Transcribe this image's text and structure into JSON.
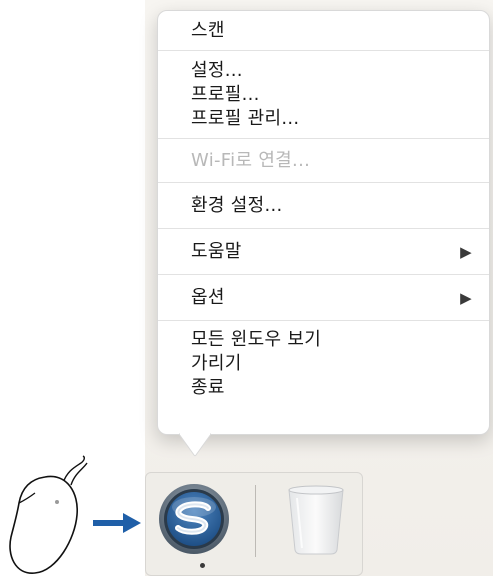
{
  "menu": {
    "items": [
      {
        "label": "스캔"
      },
      {
        "label": "설정..."
      },
      {
        "label": "프로필..."
      },
      {
        "label": "프로필 관리..."
      },
      {
        "label": "Wi-Fi로 연결..."
      },
      {
        "label": "환경 설정..."
      },
      {
        "label": "도움말",
        "submenu_arrow": "▶"
      },
      {
        "label": "옵션",
        "submenu_arrow": "▶"
      },
      {
        "label": "모든 윈도우 보기"
      },
      {
        "label": "가리기"
      },
      {
        "label": "종료"
      }
    ]
  },
  "dock": {
    "apps": [
      {
        "icon": "scansnap-s-icon",
        "running": true
      },
      {
        "icon": "trash-icon",
        "running": false
      }
    ]
  },
  "illustration": {
    "mouse_icon": "mouse-icon",
    "arrow_icon": "right-arrow-icon",
    "arrow_color": "#1f5fa8"
  }
}
